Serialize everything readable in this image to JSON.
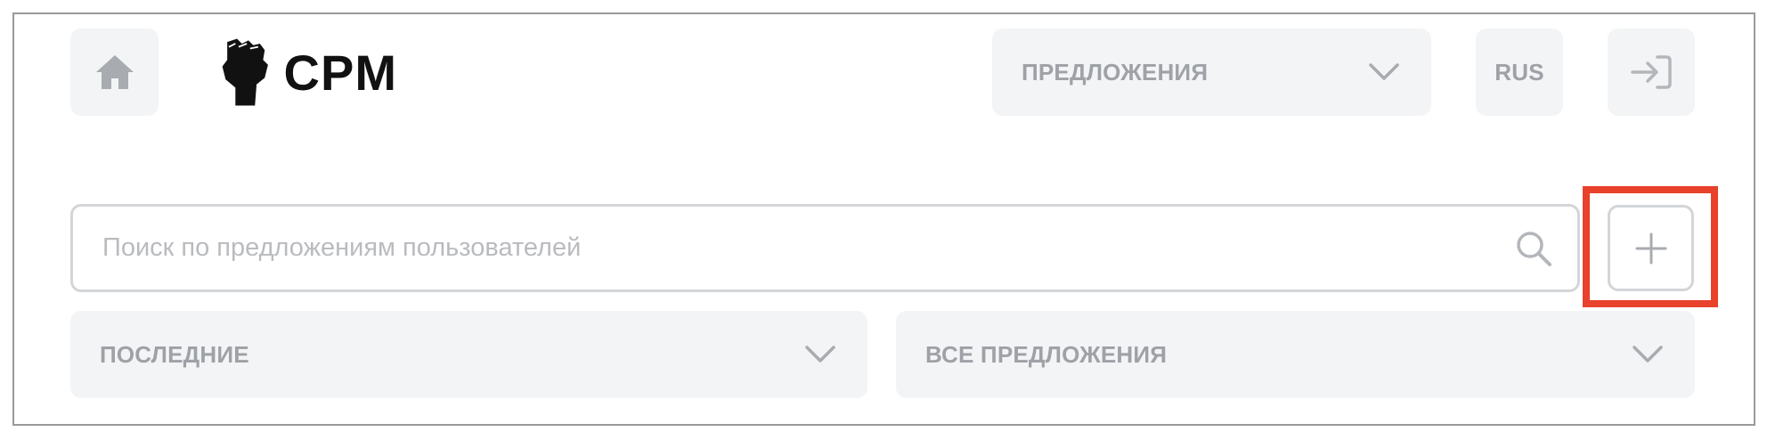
{
  "header": {
    "logo_text": "CPM",
    "section_dropdown": {
      "label": "ПРЕДЛОЖЕНИЯ",
      "icon": "chevron-down-icon"
    },
    "language_label": "RUS",
    "home_icon": "home-icon",
    "login_icon": "sign-in-icon"
  },
  "search": {
    "placeholder": "Поиск по предложениям пользователей",
    "value": "",
    "icon": "search-icon"
  },
  "add_button": {
    "icon": "plus-icon",
    "highlight_color": "#e8412c"
  },
  "filters": {
    "sort": {
      "label": "ПОСЛЕДНИЕ",
      "icon": "chevron-down-icon"
    },
    "type": {
      "label": "ВСЕ ПРЕДЛОЖЕНИЯ",
      "icon": "chevron-down-icon"
    }
  },
  "colors": {
    "tile_bg": "#f3f4f6",
    "muted_text": "#9ea1a6",
    "border": "#d3d5d8"
  }
}
